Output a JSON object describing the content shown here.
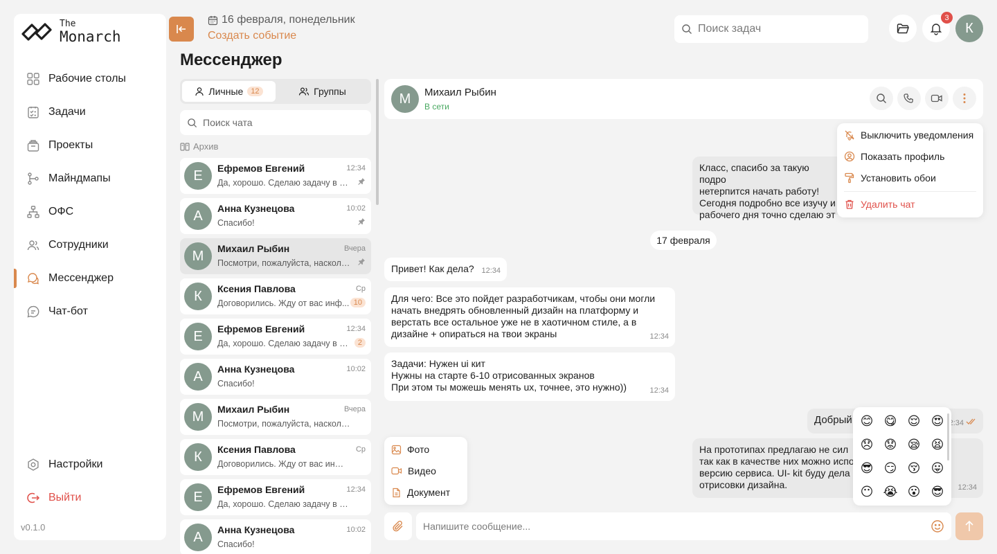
{
  "logo": {
    "small": "The",
    "big": "Monarch"
  },
  "nav": [
    {
      "label": "Рабочие столы",
      "icon": "dashboard-icon"
    },
    {
      "label": "Задачи",
      "icon": "tasks-icon"
    },
    {
      "label": "Проекты",
      "icon": "projects-icon"
    },
    {
      "label": "Майндмапы",
      "icon": "mindmap-icon"
    },
    {
      "label": "ОФС",
      "icon": "org-structure-icon"
    },
    {
      "label": "Сотрудники",
      "icon": "employees-icon"
    },
    {
      "label": "Мессенджер",
      "icon": "messenger-icon",
      "active": true
    },
    {
      "label": "Чат-бот",
      "icon": "chatbot-icon"
    }
  ],
  "nav_bottom": {
    "settings": "Настройки",
    "logout": "Выйти"
  },
  "version": "v0.1.0",
  "header": {
    "date": "16 февраля, понедельник",
    "create_event": "Создать событие",
    "search_placeholder": "Поиск задач",
    "notifications_count": "3",
    "user_initial": "К"
  },
  "page_title": "Мессенджер",
  "chat_list": {
    "tabs": [
      {
        "label": "Личные",
        "count": "12",
        "active": true
      },
      {
        "label": "Группы",
        "count": ""
      }
    ],
    "search_placeholder": "Поиск чата",
    "archive_label": "Архив",
    "items": [
      {
        "initial": "Е",
        "name": "Ефремов Евгений",
        "time": "12:34",
        "preview": "Да, хорошо. Сделаю задачу в бли...",
        "right": "pin"
      },
      {
        "initial": "А",
        "name": "Анна Кузнецова",
        "time": "10:02",
        "preview": "Спасибо!",
        "right": "pin"
      },
      {
        "initial": "М",
        "name": "Михаил Рыбин",
        "time": "Вчера",
        "preview": "Посмотри, пожалуйста, насколько ...",
        "right": "pin",
        "selected": true
      },
      {
        "initial": "К",
        "name": "Ксения Павлова",
        "time": "Ср",
        "preview": "Договорились. Жду от вас инф...",
        "right": "10"
      },
      {
        "initial": "Е",
        "name": "Ефремов Евгений",
        "time": "12:34",
        "preview": "Да, хорошо. Сделаю задачу в бл...",
        "right": "2"
      },
      {
        "initial": "А",
        "name": "Анна Кузнецова",
        "time": "10:02",
        "preview": "Спасибо!",
        "right": ""
      },
      {
        "initial": "М",
        "name": "Михаил Рыбин",
        "time": "Вчера",
        "preview": "Посмотри, пожалуйста, насколько к...",
        "right": ""
      },
      {
        "initial": "К",
        "name": "Ксения Павлова",
        "time": "Ср",
        "preview": "Договорились. Жду от вас информа...",
        "right": ""
      },
      {
        "initial": "Е",
        "name": "Ефремов Евгений",
        "time": "12:34",
        "preview": "Да, хорошо. Сделаю задачу в ближа...",
        "right": ""
      },
      {
        "initial": "А",
        "name": "Анна Кузнецова",
        "time": "10:02",
        "preview": "Спасибо!",
        "right": ""
      }
    ]
  },
  "chat": {
    "contact_initial": "М",
    "contact_name": "Михаил Рыбин",
    "contact_status": "В сети",
    "menu": {
      "mute": "Выключить уведомления",
      "profile": "Показать профиль",
      "wallpaper": "Установить обои",
      "delete": "Удалить чат"
    },
    "messages": {
      "out1": "Класс, спасибо за такую подро\nнетерпится начать работу!\nСегодня подробно все изучу и\nрабочего дня точно сделаю эт",
      "date_divider": "17 февраля",
      "in1": "Привет! Как дела?",
      "in1_time": "12:34",
      "in2": "Для чего: Все это пойдет разработчикам, чтобы они могли\nначать внедрять обновленный дизайн на платформу и\nверстать все остальное уже не в хаотичном стиле, а в\nдизайне + опираться на твои экраны",
      "in2_time": "12:34",
      "in3": "Задачи: Нужен ui кит\nНужны на старте 6-10 отрисованных экранов\nПри этом ты можешь менять ux, точнее, это нужно))",
      "in3_time": "12:34",
      "out2": "Добрый д",
      "out2_time": "12:34",
      "out3": "На прототипах предлагаю не сил\nтак как в качестве них можно испо\nверсию сервиса. UI- kit буду дела\nотрисовки дизайна.",
      "out3_time": "12:34"
    },
    "attach_menu": {
      "photo": "Фото",
      "video": "Видео",
      "document": "Документ"
    },
    "emojis": [
      "😊",
      "😋",
      "😌",
      "😍",
      "😞",
      "😟",
      "😪",
      "😫",
      "😎",
      "😏",
      "😚",
      "😛",
      "😶",
      "😭",
      "😮",
      "😎"
    ],
    "input_placeholder": "Напишите сообщение..."
  },
  "colors": {
    "accent": "#d9884d",
    "avatar": "#859a8e",
    "online": "#48a860",
    "danger": "#e0504a"
  }
}
